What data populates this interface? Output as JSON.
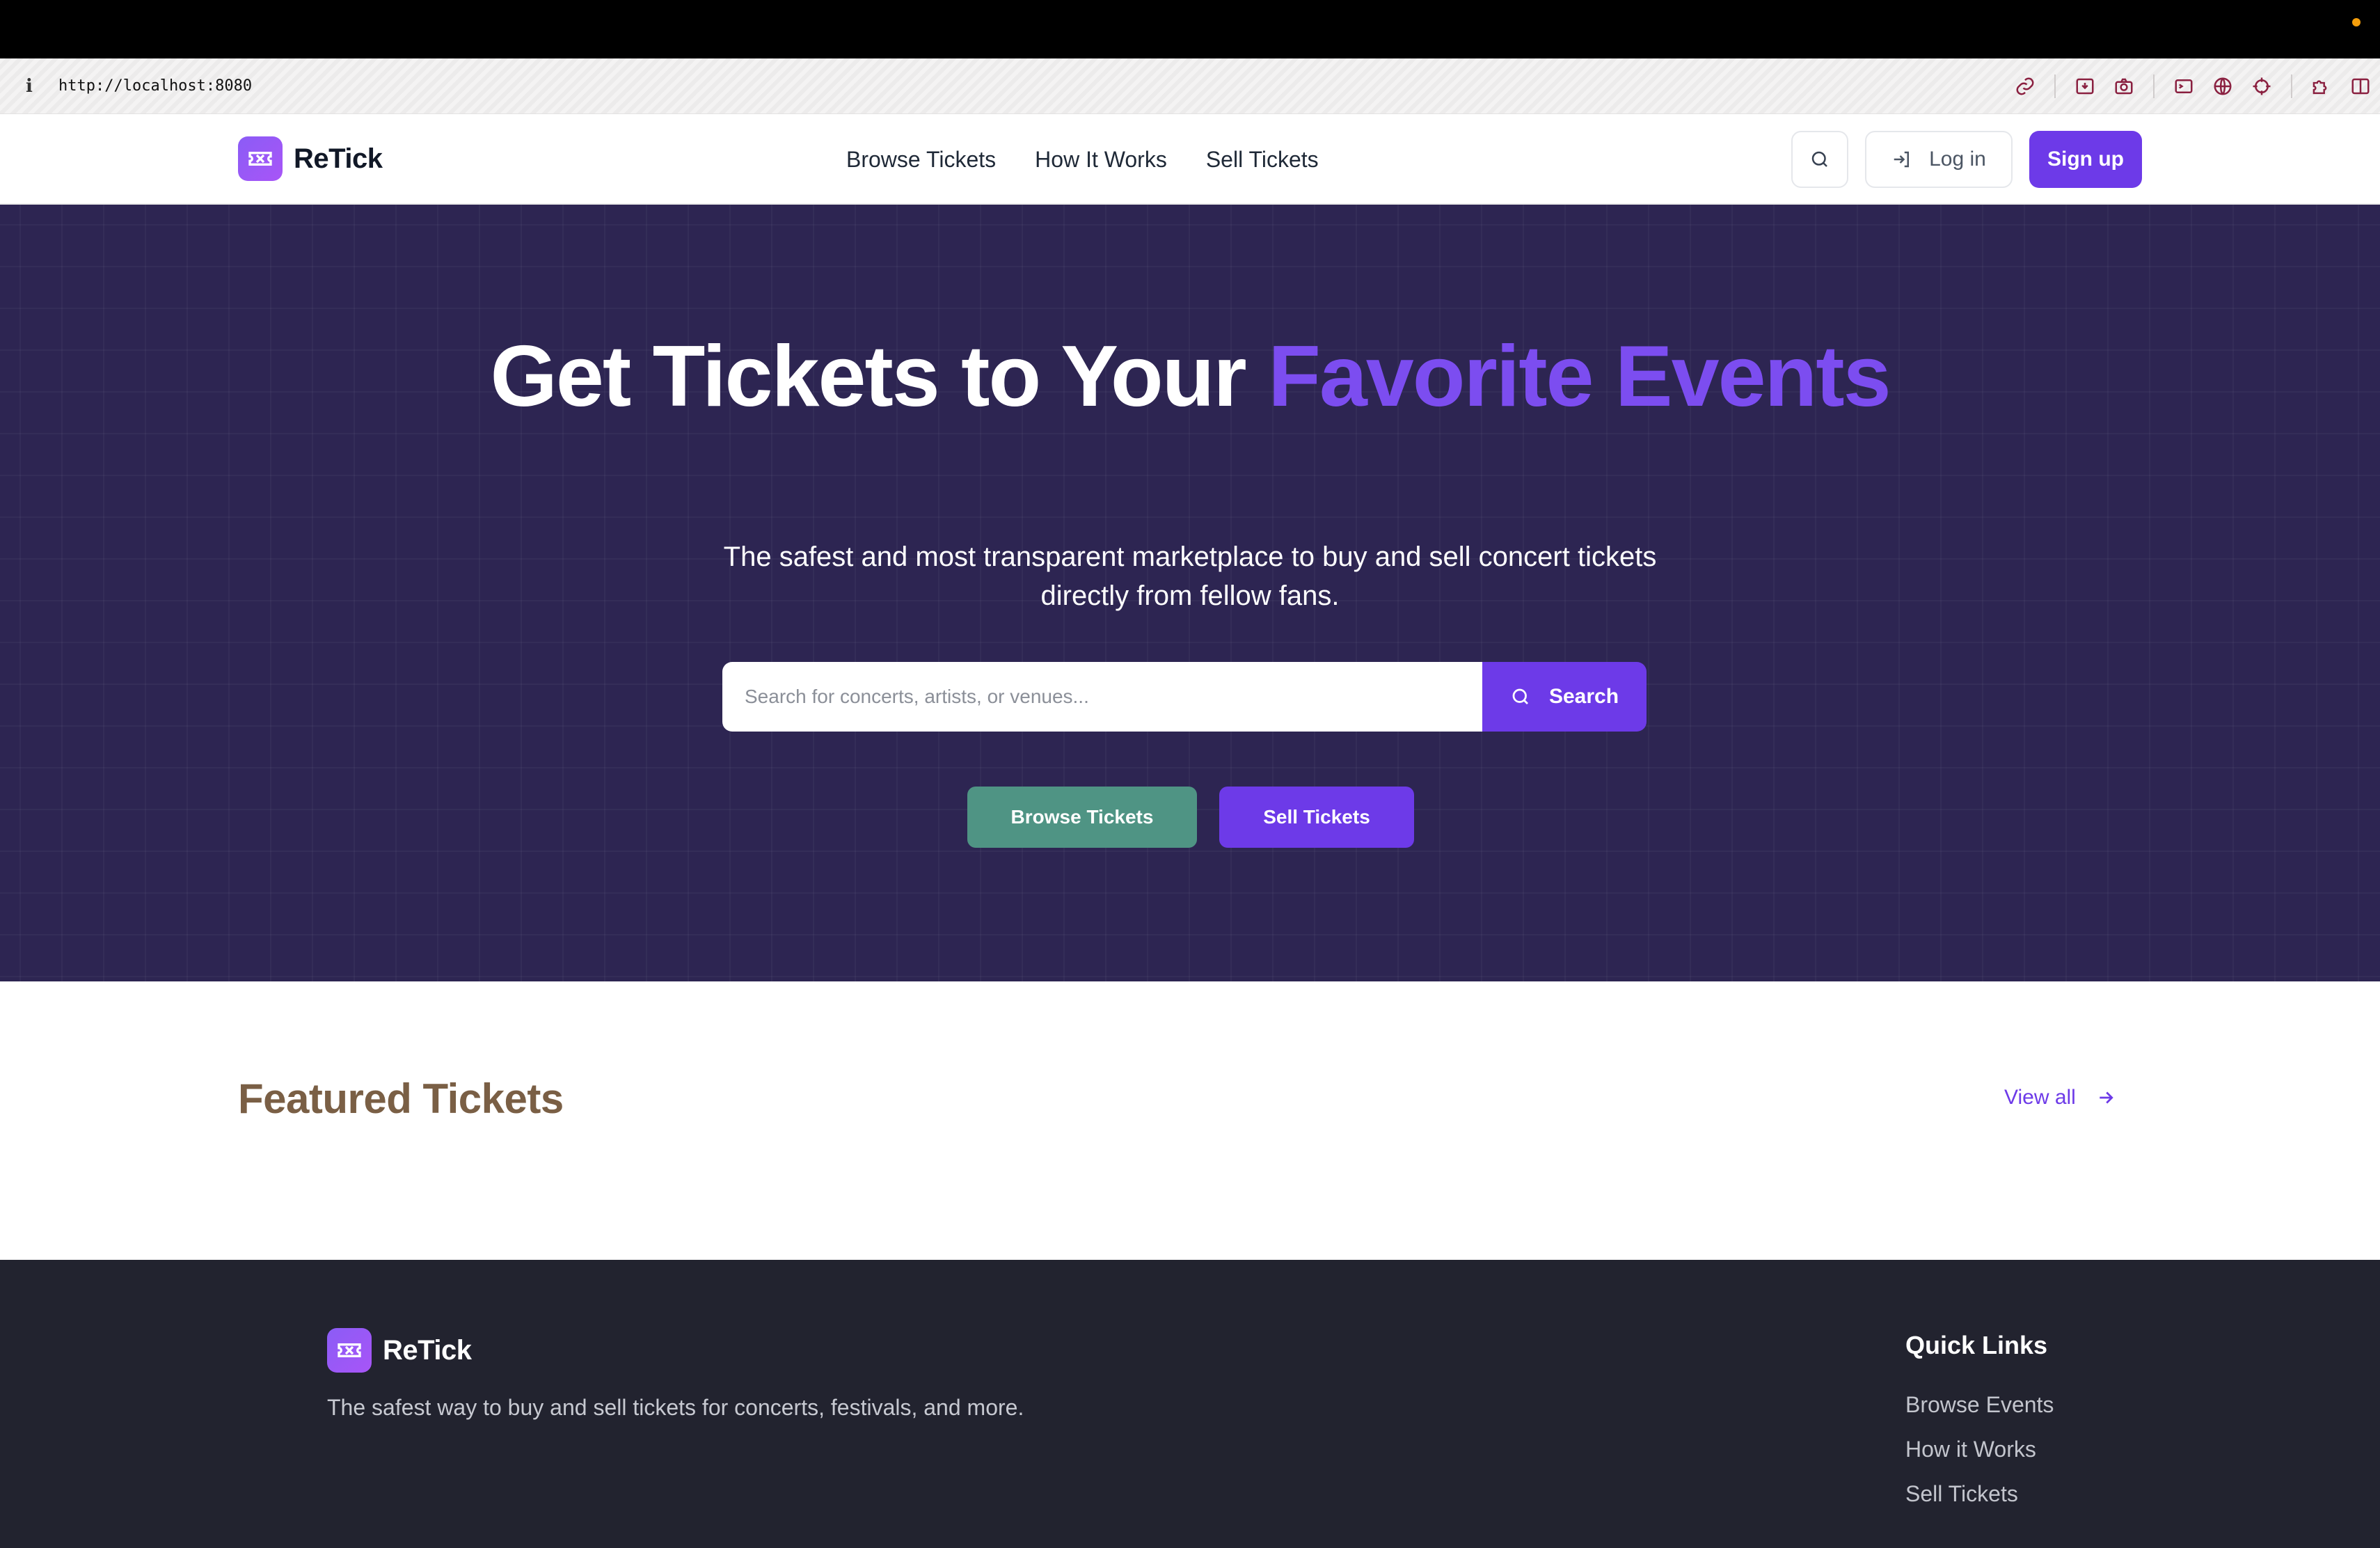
{
  "browser": {
    "url": "http://localhost:8080",
    "info_glyph": "i"
  },
  "colors": {
    "primary": "#6d3ae8",
    "hero_bg": "#2d2552",
    "teal": "#4f9484",
    "footer_bg": "#22232f",
    "featured_title": "#7a5f45",
    "status_dot": "#f59e0b"
  },
  "header": {
    "brand": "ReTick",
    "nav": [
      "Browse Tickets",
      "How It Works",
      "Sell Tickets"
    ],
    "login_label": "Log in",
    "signup_label": "Sign up"
  },
  "hero": {
    "title_main": "Get Tickets to Your ",
    "title_accent": "Favorite Events",
    "subtitle": "The safest and most transparent marketplace to buy and sell concert tickets directly from fellow fans.",
    "search_placeholder": "Search for concerts, artists, or venues...",
    "search_button": "Search",
    "cta_browse": "Browse Tickets",
    "cta_sell": "Sell Tickets"
  },
  "featured": {
    "title": "Featured Tickets",
    "view_all": "View all"
  },
  "footer": {
    "brand": "ReTick",
    "tagline": "The safest way to buy and sell tickets for concerts, festivals, and more.",
    "quick_links_title": "Quick Links",
    "quick_links": [
      "Browse Events",
      "How it Works",
      "Sell Tickets"
    ]
  },
  "icons": {
    "ticket_logo": "ticket-icon",
    "search": "search-icon",
    "login": "login-icon",
    "arrow": "arrow-right-icon"
  }
}
